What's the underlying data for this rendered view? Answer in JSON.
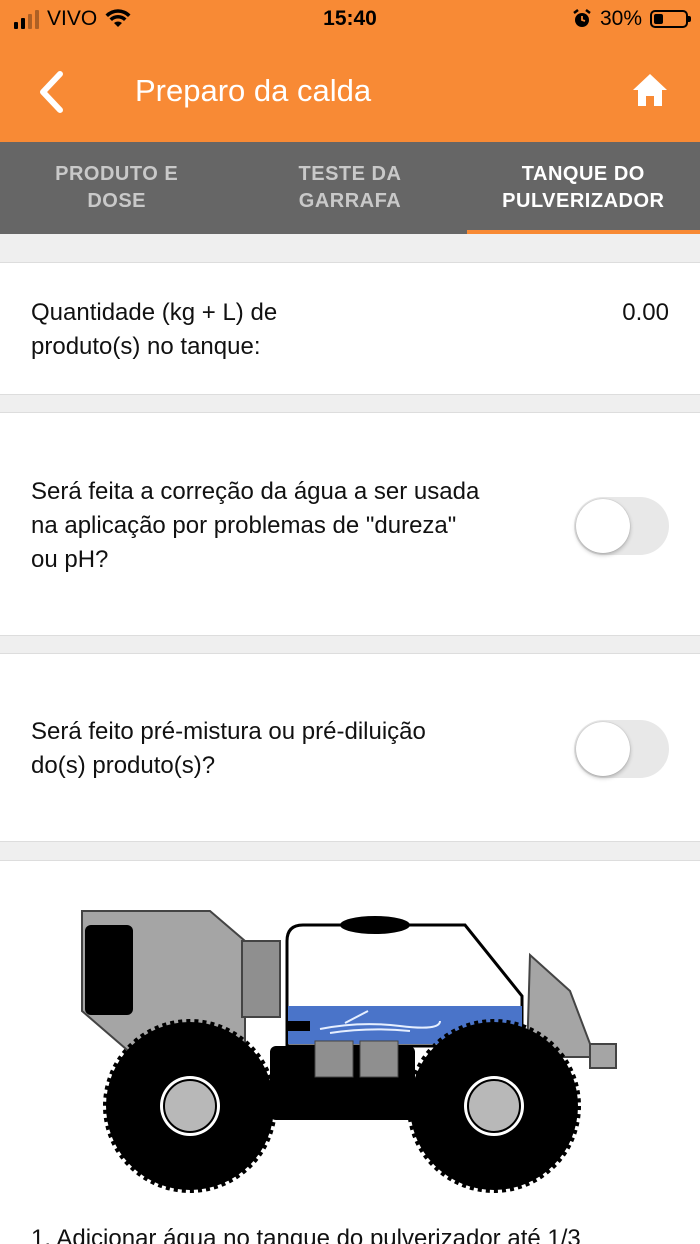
{
  "status_bar": {
    "carrier": "VIVO",
    "time": "15:40",
    "battery": "30%",
    "battery_level": 0.3
  },
  "nav": {
    "title": "Preparo da calda",
    "back_icon": "chevron-left-icon",
    "home_icon": "home-icon"
  },
  "tabs": [
    {
      "label": "PRODUTO E\nDOSE",
      "active": false
    },
    {
      "label": "TESTE DA\nGARRAFA",
      "active": false
    },
    {
      "label": "TANQUE DO\nPULVERIZADOR",
      "active": true
    }
  ],
  "quantity": {
    "label": "Quantidade (kg + L) de\nproduto(s) no tanque:",
    "value": "0.00"
  },
  "water_correction": {
    "label": "Será feita a correção da água a ser usada\nna aplicação por problemas de \"dureza\"\nou pH?",
    "enabled": false
  },
  "premix": {
    "label": "Será feito pré-mistura ou pré-diluição\ndo(s) produto(s)?",
    "enabled": false
  },
  "instructions": {
    "step_1": "1. Adicionar água no tanque do pulverizador até 1/3"
  },
  "colors": {
    "brand": "#f88a35",
    "tab_bar": "#666666",
    "water": "#4a74c9"
  }
}
